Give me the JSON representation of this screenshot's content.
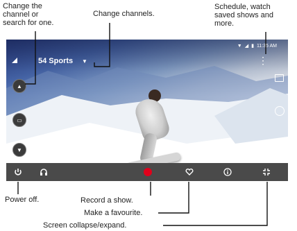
{
  "callouts": {
    "change_or_search": "Change the\nchannel or\nsearch for one.",
    "change_channels": "Change channels.",
    "schedule": "Schedule, watch\nsaved shows and\nmore.",
    "power_off": "Power off.",
    "record": "Record a show.",
    "favourite": "Make a favourite.",
    "collapse": "Screen collapse/expand."
  },
  "screen": {
    "channel_label": "54 Sports",
    "time": "11:35 AM"
  },
  "icons": {
    "power": "power-icon",
    "headphones": "headphones-icon",
    "record": "record-icon",
    "favourite": "heart-icon",
    "info": "info-icon",
    "collapse": "collapse-icon"
  },
  "colors": {
    "record": "#e0001b",
    "bottom_bar": "#4a4a4a"
  }
}
